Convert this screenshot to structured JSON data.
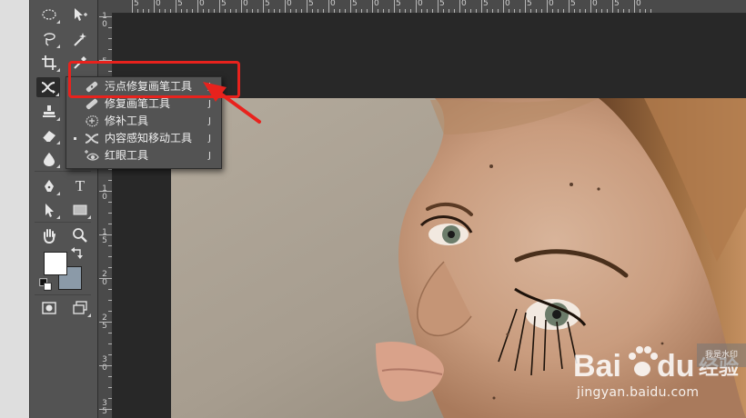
{
  "tools_panel": {
    "type_tool_label": "T"
  },
  "ruler": {
    "top_labels": [
      "5",
      "0",
      "5",
      "0",
      "5",
      "0",
      "5",
      "0",
      "5",
      "0",
      "5",
      "0",
      "5",
      "0",
      "5",
      "0",
      "5",
      "0",
      "5",
      "0",
      "5",
      "0",
      "5",
      "0"
    ],
    "left_labels": [
      "1\n0",
      "5",
      "1\n0",
      "1\n5",
      "2\n0",
      "2\n5",
      "3\n0",
      "3\n5"
    ]
  },
  "flyout": {
    "items": [
      {
        "label": "污点修复画笔工具",
        "shortcut": "J",
        "icon": "spot-healing-brush-icon",
        "selected": false
      },
      {
        "label": "修复画笔工具",
        "shortcut": "J",
        "icon": "healing-brush-icon",
        "selected": false
      },
      {
        "label": "修补工具",
        "shortcut": "J",
        "icon": "patch-icon",
        "selected": false
      },
      {
        "label": "内容感知移动工具",
        "shortcut": "J",
        "icon": "content-aware-move-icon",
        "selected": true
      },
      {
        "label": "红眼工具",
        "shortcut": "J",
        "icon": "red-eye-icon",
        "selected": false
      }
    ]
  },
  "colors": {
    "foreground": "#ffffff",
    "background": "#8b9aa8",
    "highlight": "#e8221d"
  },
  "watermark": {
    "brand_logo_text": "Baidu经验",
    "url": "jingyan.baidu.com",
    "tag": "我是水印"
  }
}
